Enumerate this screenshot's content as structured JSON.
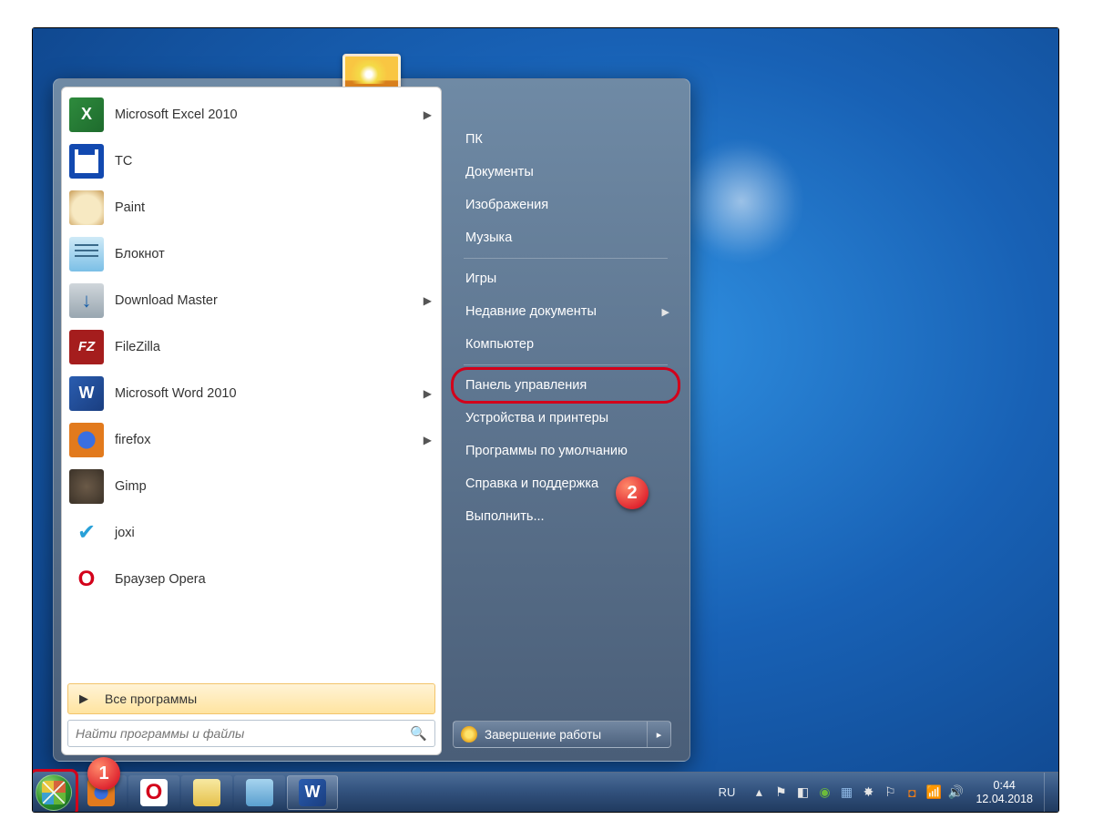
{
  "programs": [
    {
      "label": "Microsoft Excel 2010",
      "icon": "i-excel",
      "arrow": true
    },
    {
      "label": "TC",
      "icon": "i-tc",
      "arrow": false
    },
    {
      "label": "Paint",
      "icon": "i-paint",
      "arrow": false
    },
    {
      "label": "Блокнот",
      "icon": "i-note",
      "arrow": false
    },
    {
      "label": "Download Master",
      "icon": "i-dm",
      "arrow": true
    },
    {
      "label": "FileZilla",
      "icon": "i-fz",
      "arrow": false
    },
    {
      "label": "Microsoft Word 2010",
      "icon": "i-word",
      "arrow": true
    },
    {
      "label": "firefox",
      "icon": "i-ff",
      "arrow": true
    },
    {
      "label": "Gimp",
      "icon": "i-gimp",
      "arrow": false
    },
    {
      "label": "joxi",
      "icon": "i-joxi",
      "arrow": false
    },
    {
      "label": "Браузер Opera",
      "icon": "i-opera",
      "arrow": false
    }
  ],
  "all_programs": "Все программы",
  "search_placeholder": "Найти программы и файлы",
  "right_items": [
    {
      "label": "ПК"
    },
    {
      "label": "Документы"
    },
    {
      "label": "Изображения"
    },
    {
      "label": "Музыка"
    },
    {
      "sep": true
    },
    {
      "label": "Игры"
    },
    {
      "label": "Недавние документы",
      "arrow": true
    },
    {
      "label": "Компьютер"
    },
    {
      "sep": true
    },
    {
      "label": "Панель управления",
      "highlight": true
    },
    {
      "label": "Устройства и принтеры"
    },
    {
      "label": "Программы по умолчанию"
    },
    {
      "label": "Справка и поддержка"
    },
    {
      "label": "Выполнить..."
    }
  ],
  "shutdown": "Завершение работы",
  "tray": {
    "lang": "RU",
    "time": "0:44",
    "date": "12.04.2018"
  },
  "callouts": {
    "one": "1",
    "two": "2"
  }
}
